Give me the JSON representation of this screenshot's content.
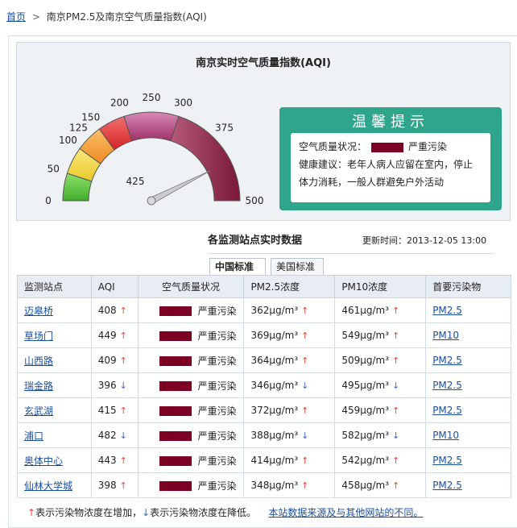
{
  "breadcrumb": {
    "home": "首页",
    "sep": ">",
    "current": "南京PM2.5及南京空气质量指数(AQI)"
  },
  "gauge": {
    "title": "南京实时空气质量指数(AQI)",
    "value": 425,
    "value_label": "425",
    "ticks": [
      "0",
      "50",
      "100",
      "125",
      "150",
      "200",
      "250",
      "300",
      "375",
      "500"
    ]
  },
  "tip": {
    "header": "温馨提示",
    "status_label": "空气质量状况：",
    "status_text": "严重污染",
    "advice_label": "健康建议：",
    "advice_text": "老年人病人应留在室内，停止体力消耗，一般人群避免户外活动"
  },
  "stations_section": {
    "title": "各监测站点实时数据",
    "update_label": "更新时间：",
    "update_time": "2013-12-05 13:00",
    "tabs": [
      {
        "label": "中国标准"
      },
      {
        "label": "美国标准"
      }
    ]
  },
  "table": {
    "headers": [
      "监测站点",
      "AQI",
      "空气质量状况",
      "PM2.5浓度",
      "PM10浓度",
      "首要污染物"
    ],
    "rows": [
      {
        "station": "迈皋桥",
        "aqi": "408",
        "aqi_trend": "up",
        "status": "严重污染",
        "pm25": "362μg/m³",
        "pm25_trend": "up",
        "pm10": "461μg/m³",
        "pm10_trend": "up",
        "primary": "PM2.5"
      },
      {
        "station": "草场门",
        "aqi": "449",
        "aqi_trend": "up",
        "status": "严重污染",
        "pm25": "369μg/m³",
        "pm25_trend": "up",
        "pm10": "549μg/m³",
        "pm10_trend": "up",
        "primary": "PM10"
      },
      {
        "station": "山西路",
        "aqi": "409",
        "aqi_trend": "up",
        "status": "严重污染",
        "pm25": "364μg/m³",
        "pm25_trend": "up",
        "pm10": "509μg/m³",
        "pm10_trend": "up",
        "primary": "PM2.5"
      },
      {
        "station": "瑞金路",
        "aqi": "396",
        "aqi_trend": "down",
        "status": "严重污染",
        "pm25": "346μg/m³",
        "pm25_trend": "down",
        "pm10": "495μg/m³",
        "pm10_trend": "down",
        "primary": "PM2.5"
      },
      {
        "station": "玄武湖",
        "aqi": "415",
        "aqi_trend": "up",
        "status": "严重污染",
        "pm25": "372μg/m³",
        "pm25_trend": "up",
        "pm10": "459μg/m³",
        "pm10_trend": "up",
        "primary": "PM2.5"
      },
      {
        "station": "浦口",
        "aqi": "482",
        "aqi_trend": "down",
        "status": "严重污染",
        "pm25": "388μg/m³",
        "pm25_trend": "down",
        "pm10": "582μg/m³",
        "pm10_trend": "down",
        "primary": "PM10"
      },
      {
        "station": "奥体中心",
        "aqi": "443",
        "aqi_trend": "up",
        "status": "严重污染",
        "pm25": "414μg/m³",
        "pm25_trend": "up",
        "pm10": "542μg/m³",
        "pm10_trend": "up",
        "primary": "PM2.5"
      },
      {
        "station": "仙林大学城",
        "aqi": "398",
        "aqi_trend": "up",
        "status": "严重污染",
        "pm25": "348μg/m³",
        "pm25_trend": "up",
        "pm10": "458μg/m³",
        "pm10_trend": "up",
        "primary": "PM2.5"
      }
    ]
  },
  "legend": {
    "up_text": "表示污染物浓度在增加，",
    "down_text": "表示污染物浓度在降低。",
    "link_text": "本站数据来源及与其他网站的不同。"
  },
  "colors": {
    "severe": "#7b0023",
    "tip_bg": "#2fa68c",
    "up_arrow": "#e2472f",
    "down_arrow": "#3a64c8"
  }
}
